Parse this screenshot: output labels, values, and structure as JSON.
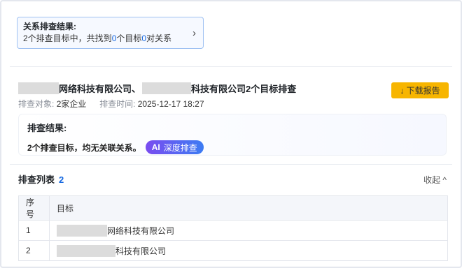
{
  "summary": {
    "title": "关系排查结果:",
    "text_prefix": "2个排查目标中，共找到",
    "found_count": "0",
    "text_mid": "个目标",
    "relation_count": "0",
    "text_suffix": "对关系",
    "chevron": "›"
  },
  "report": {
    "title_part1": "网络科技有限公司、",
    "title_part2": "科技有限公司2个目标排查",
    "download_label": "下载报告",
    "download_icon": "↓",
    "meta_object_label": "排查对象:",
    "meta_object_value": "2家企业",
    "meta_time_label": "排查时间:",
    "meta_time_value": "2025-12-17 18:27"
  },
  "result": {
    "title": "排查结果:",
    "text": "2个排查目标，均无关联关系。",
    "ai_mark": "AI",
    "ai_label": "深度排查"
  },
  "list": {
    "title": "排查列表",
    "count": "2",
    "collapse_label": "收起",
    "collapse_icon": "^",
    "columns": [
      "序号",
      "目标"
    ],
    "rows": [
      {
        "no": "1",
        "target": "网络科技有限公司"
      },
      {
        "no": "2",
        "target": "科技有限公司"
      }
    ]
  }
}
